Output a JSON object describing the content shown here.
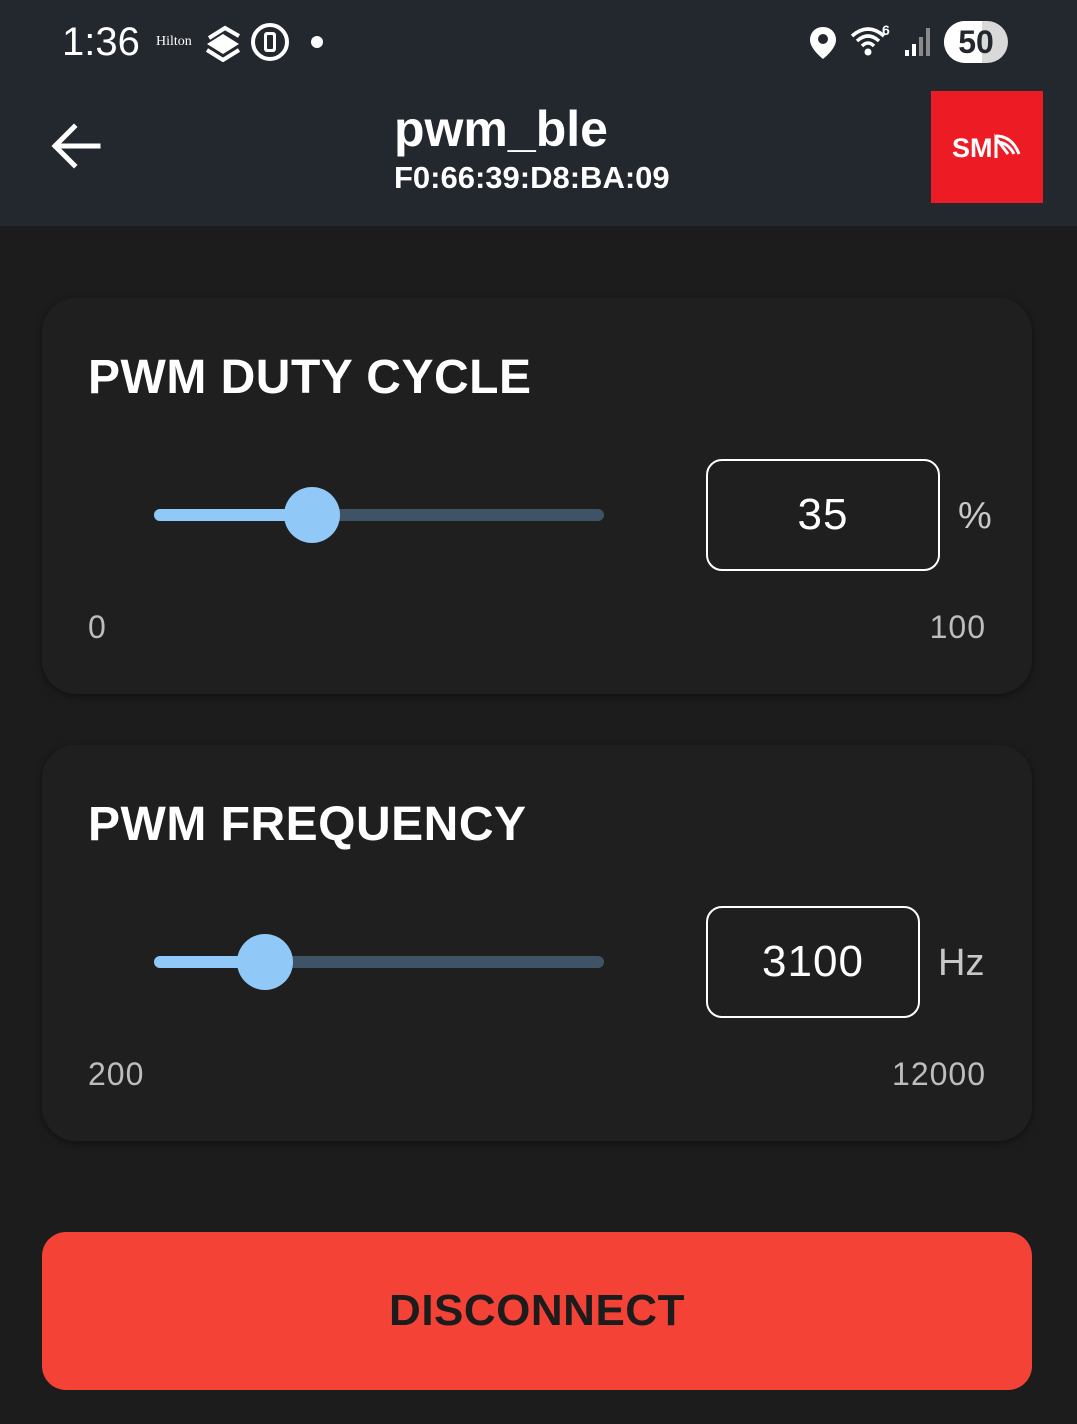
{
  "status_bar": {
    "time": "1:36",
    "hilton_label": "Hilton",
    "battery_level": "50",
    "icons": [
      "hilton-label",
      "stack-icon",
      "watch-icon",
      "dot-icon",
      "location-icon",
      "wifi-6-icon",
      "signal-icon",
      "battery-icon"
    ]
  },
  "app_bar": {
    "title": "pwm_ble",
    "subtitle": "F0:66:39:D8:BA:09",
    "logo_text": "SM",
    "logo_color": "#ed1c24",
    "back_icon": "arrow-back-icon"
  },
  "duty_cycle": {
    "title": "PWM DUTY CYCLE",
    "value": "35",
    "unit": "%",
    "min": "0",
    "max": "100",
    "slider_fraction": 0.35
  },
  "frequency": {
    "title": "PWM FREQUENCY",
    "value": "3100",
    "unit": "Hz",
    "min": "200",
    "max": "12000",
    "slider_fraction": 0.246
  },
  "disconnect_label": "DISCONNECT",
  "colors": {
    "background": "#1c1c1d",
    "bar": "#23272e",
    "slider_active": "#90c8f8",
    "slider_inactive": "#3f5366",
    "disconnect": "#f44336"
  }
}
